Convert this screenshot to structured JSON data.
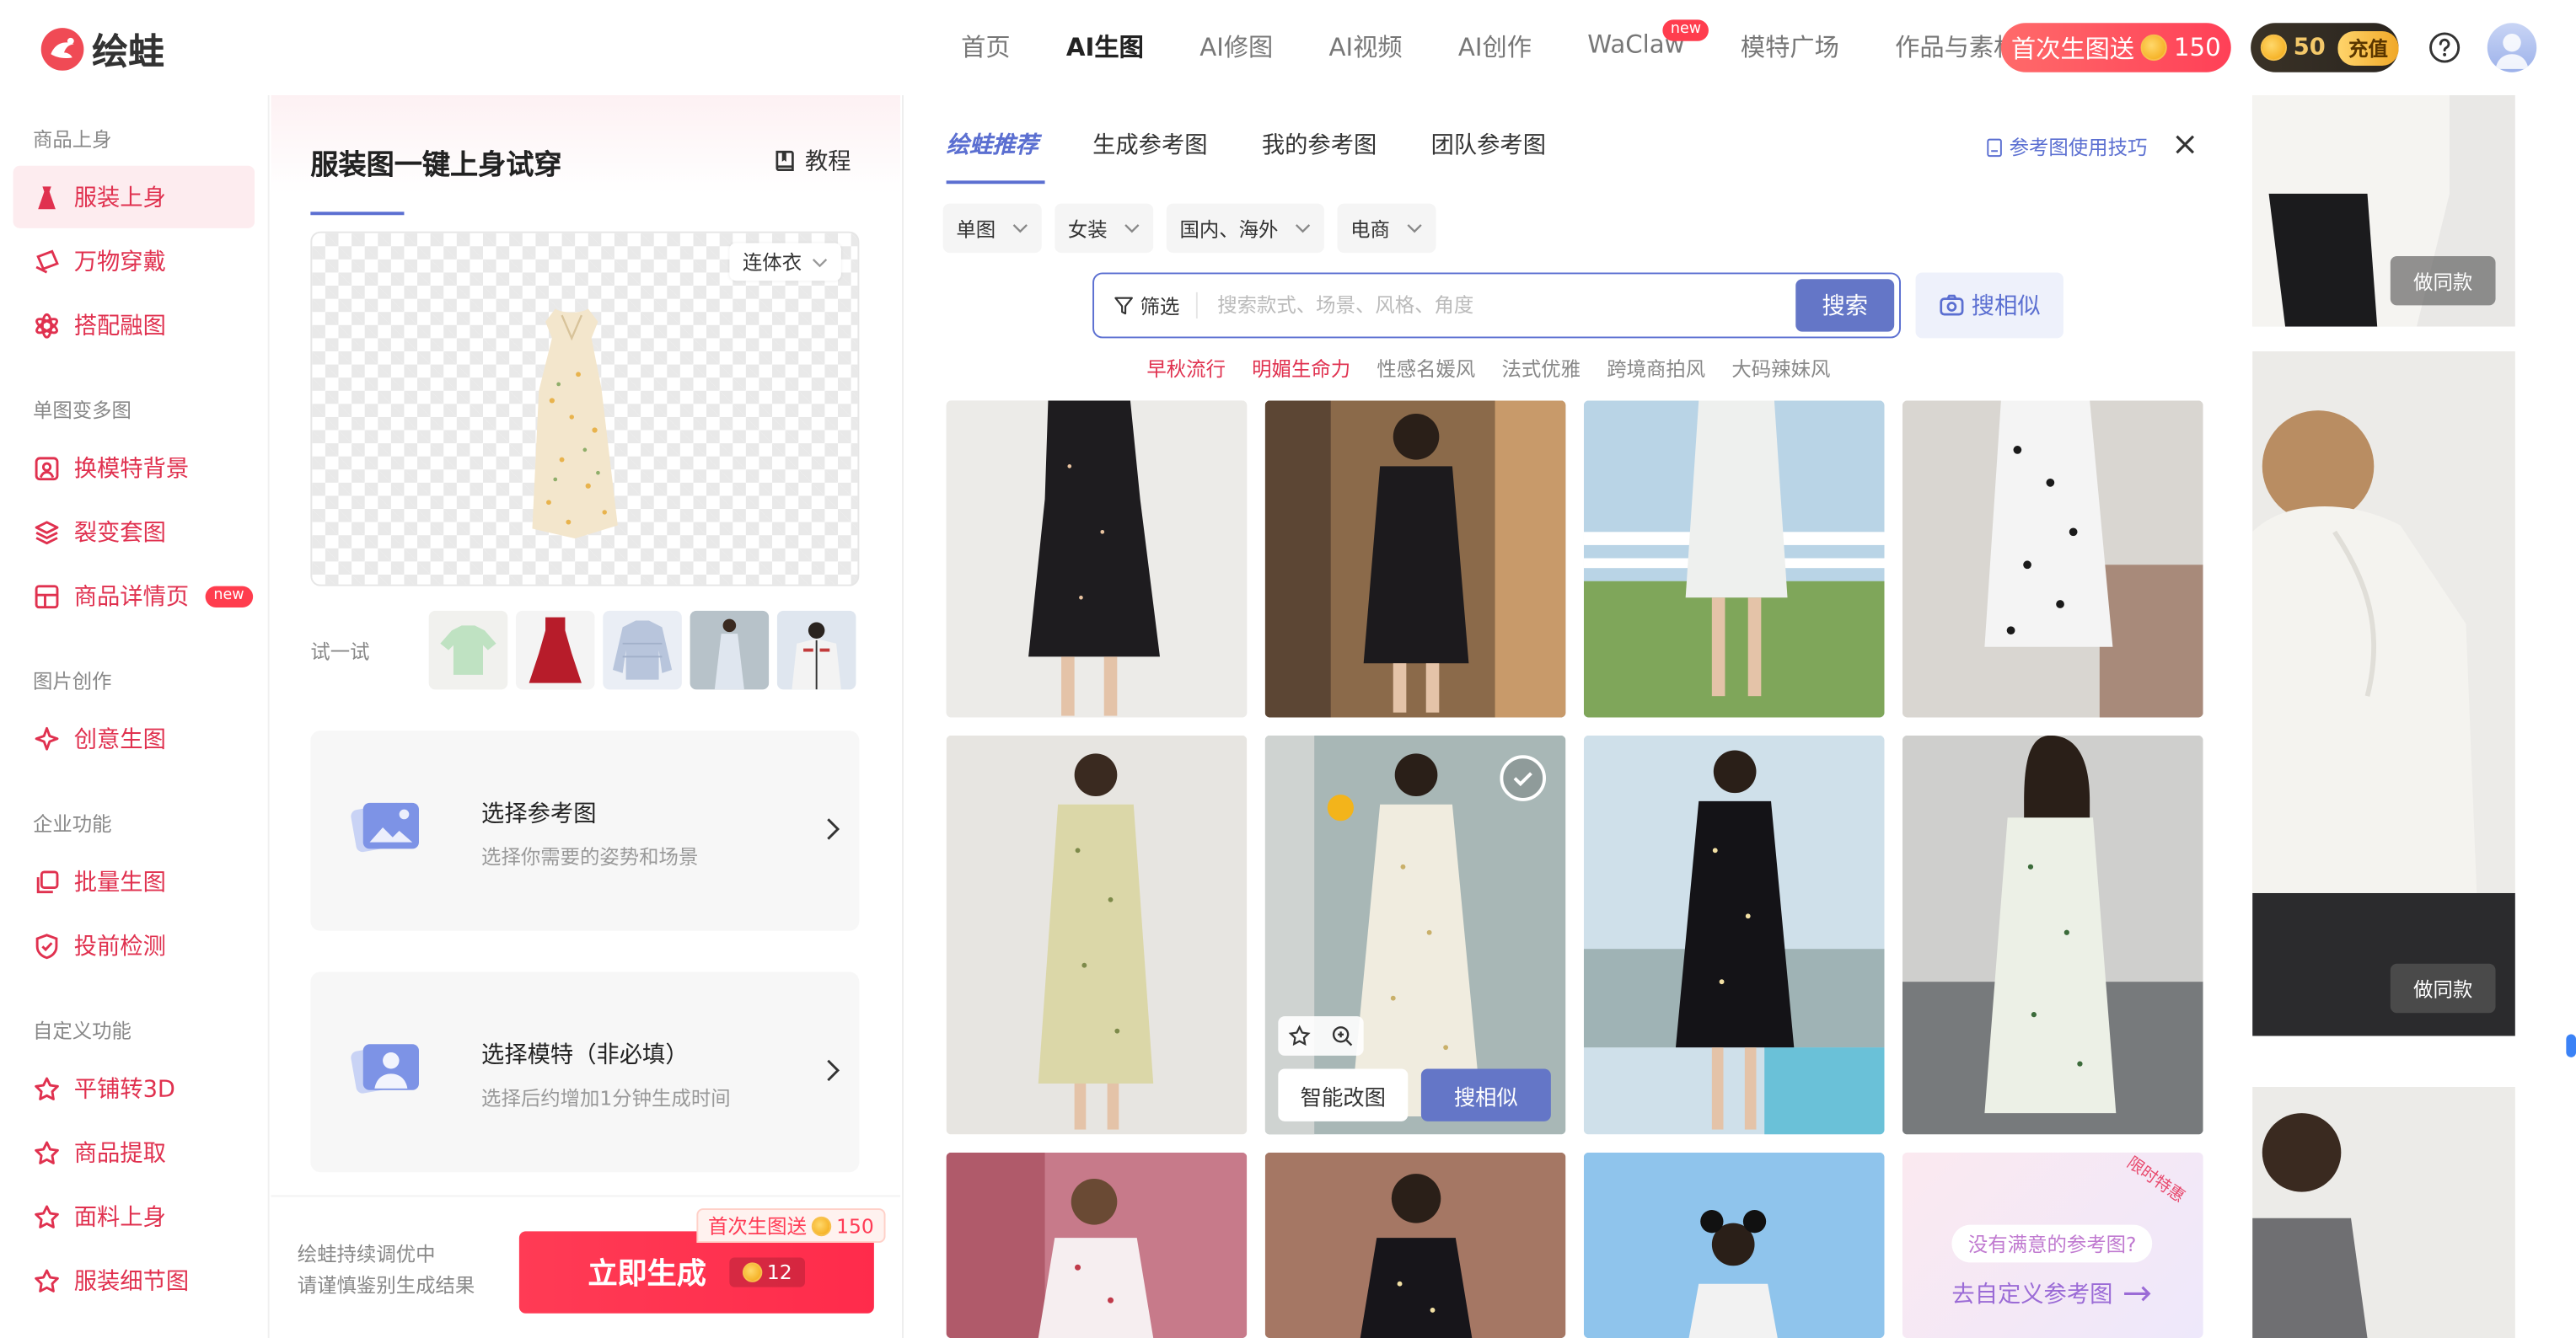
{
  "header": {
    "logo_text": "绘蛙",
    "nav": [
      "首页",
      "AI生图",
      "AI修图",
      "AI视频",
      "AI创作",
      "WaClaw",
      "模特广场",
      "作品与素材"
    ],
    "nav_active": "AI生图",
    "nav_new_badge": "new",
    "promo_label": "首次生图送",
    "promo_points": "150",
    "balance": "50",
    "recharge_label": "充值"
  },
  "sidebar": {
    "groups": [
      {
        "title": "商品上身",
        "items": [
          "服装上身",
          "万物穿戴",
          "搭配融图"
        ]
      },
      {
        "title": "单图变多图",
        "items": [
          "换模特背景",
          "裂变套图",
          "商品详情页"
        ]
      },
      {
        "title": "图片创作",
        "items": [
          "创意生图"
        ]
      },
      {
        "title": "企业功能",
        "items": [
          "批量生图",
          "投前检测"
        ]
      },
      {
        "title": "自定义功能",
        "items": [
          "平铺转3D",
          "商品提取",
          "面料上身",
          "服装细节图"
        ]
      }
    ],
    "active_item": "服装上身",
    "new_badge": "new"
  },
  "panel": {
    "title": "服装图一键上身试穿",
    "tutorial": "教程",
    "category": "连体衣",
    "try_label": "试一试",
    "card_ref_title": "选择参考图",
    "card_ref_sub": "选择你需要的姿势和场景",
    "card_model_title": "选择模特（非必填）",
    "card_model_sub": "选择后约增加1分钟生成时间",
    "note_line1": "绘蛙持续调优中",
    "note_line2": "请谨慎鉴别生成结果",
    "generate": "立即生成",
    "generate_cost": "12",
    "generate_promo": "首次生图送",
    "generate_promo_points": "150"
  },
  "ref": {
    "tabs": [
      "绘蛙推荐",
      "生成参考图",
      "我的参考图",
      "团队参考图"
    ],
    "tips": "参考图使用技巧",
    "filters": [
      "单图",
      "女装",
      "国内、海外",
      "电商"
    ],
    "search_filter": "筛选",
    "search_placeholder": "搜索款式、场景、风格、角度",
    "search_btn": "搜索",
    "similar_btn": "搜相似",
    "hot_tags": [
      "早秋流行",
      "明媚生命力",
      "性感名媛风",
      "法式优雅",
      "跨境商拍风",
      "大码辣妹风"
    ],
    "smart_edit": "智能改图",
    "search_similar": "搜相似",
    "custom_q": "没有满意的参考图?",
    "custom_link": "去自定义参考图",
    "custom_ribbon": "限时特惠"
  },
  "strip": {
    "same_btn": "做同款"
  },
  "colors": {
    "brand_red": "#e0314f",
    "accent_blue": "#5b6fd1",
    "button_blue": "#6476c7"
  }
}
